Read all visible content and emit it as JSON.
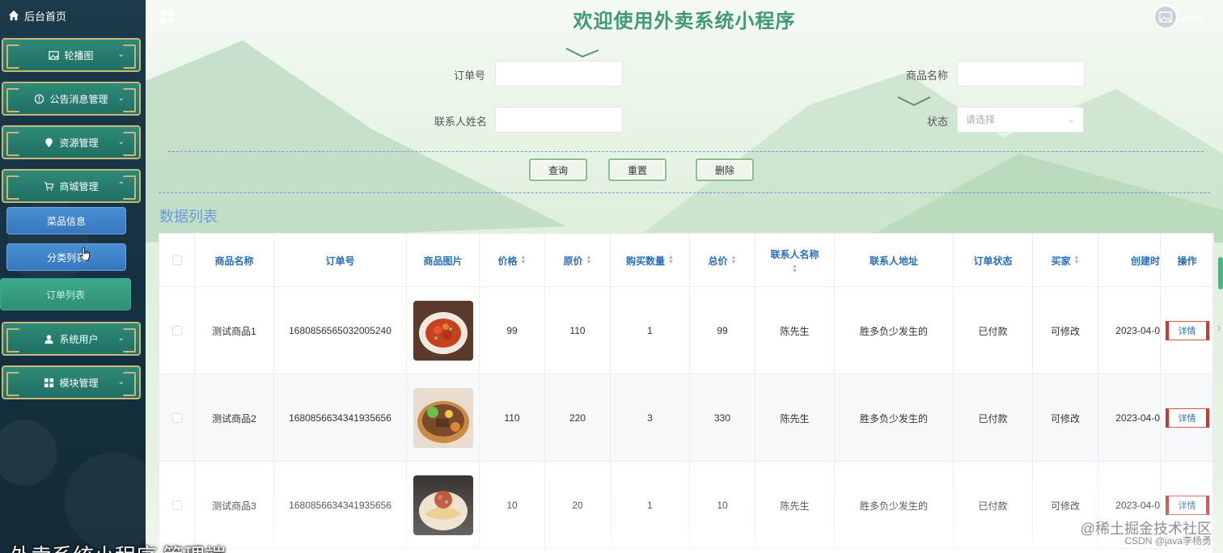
{
  "sidebar": {
    "home_label": "后台首页",
    "menu": [
      {
        "label": "轮播图",
        "icon": "image-icon"
      },
      {
        "label": "公告消息管理",
        "icon": "info-icon"
      },
      {
        "label": "资源管理",
        "icon": "location-icon"
      },
      {
        "label": "商城管理",
        "icon": "cart-icon"
      },
      {
        "label": "系统用户",
        "icon": "user-icon"
      },
      {
        "label": "模块管理",
        "icon": "grid-icon"
      }
    ],
    "submenu": [
      {
        "label": "菜品信息"
      },
      {
        "label": "分类列表"
      },
      {
        "label": "订单列表",
        "active": true
      }
    ]
  },
  "header": {
    "title": "欢迎使用外卖系统小程序",
    "username": "admin"
  },
  "search": {
    "order_no_label": "订单号",
    "product_name_label": "商品名称",
    "contact_name_label": "联系人姓名",
    "status_label": "状态",
    "status_placeholder": "请选择",
    "order_no_value": "",
    "product_name_value": "",
    "contact_name_value": ""
  },
  "buttons": {
    "query": "查询",
    "reset": "重置",
    "delete": "删除"
  },
  "section_title": "数据列表",
  "table": {
    "columns": [
      "商品名称",
      "订单号",
      "商品图片",
      "价格",
      "原价",
      "购买数量",
      "总价",
      "联系人名称",
      "联系人地址",
      "订单状态",
      "买家",
      "创建时",
      "操作"
    ],
    "rows": [
      {
        "name": "测试商品1",
        "order_no": "1680856565032005240",
        "price": "99",
        "original": "110",
        "qty": "1",
        "total": "99",
        "contact": "陈先生",
        "address": "胜多负少发生的",
        "status": "已付款",
        "buyer": "可修改",
        "created": "2023-04-0",
        "action": "详情"
      },
      {
        "name": "测试商品2",
        "order_no": "1680856634341935656",
        "price": "110",
        "original": "220",
        "qty": "3",
        "total": "330",
        "contact": "陈先生",
        "address": "胜多负少发生的",
        "status": "已付款",
        "buyer": "可修改",
        "created": "2023-04-0",
        "action": "详情"
      },
      {
        "name": "测试商品3",
        "order_no": "1680856634341935656",
        "price": "10",
        "original": "20",
        "qty": "1",
        "total": "10",
        "contact": "陈先生",
        "address": "胜多负少发生的",
        "status": "已付款",
        "buyer": "可修改",
        "created": "2023-04-0",
        "action": "详情"
      }
    ]
  },
  "overlay": {
    "caption": "外卖系统小程序 管理端",
    "watermark_main": "@稀土掘金技术社区",
    "watermark_sub": "CSDN @java李杨勇"
  }
}
